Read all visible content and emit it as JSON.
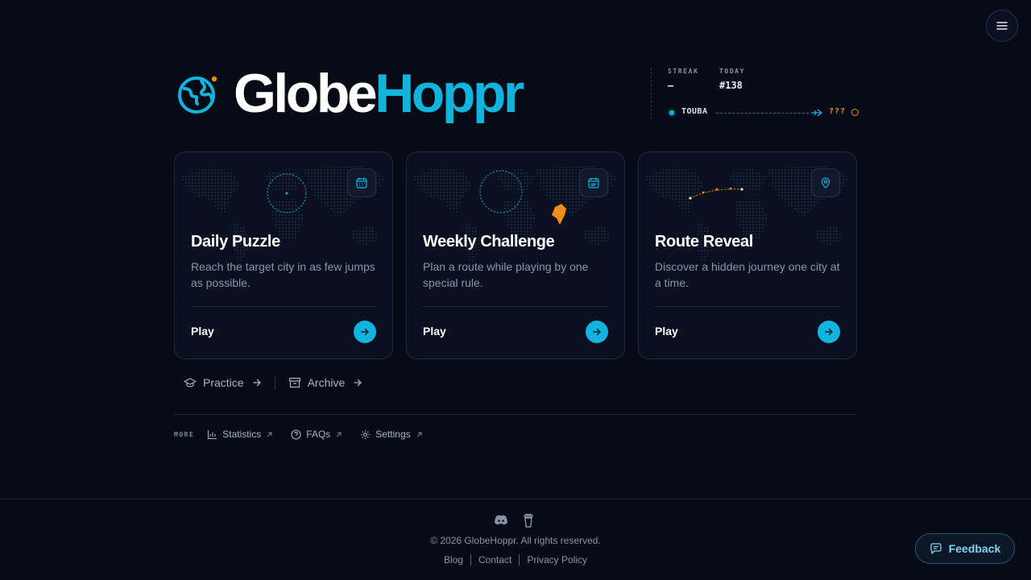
{
  "brand": {
    "part1": "Globe",
    "part2": "Hoppr",
    "accent": "#12b3dc",
    "orange": "#f08c1a"
  },
  "stats": {
    "streak_label": "STREAK",
    "streak_value": "–",
    "today_label": "TODAY",
    "today_value": "#138",
    "from_city": "TOUBA",
    "target": "???"
  },
  "cards": [
    {
      "title": "Daily Puzzle",
      "description": "Reach the target city in as few jumps as possible.",
      "play": "Play",
      "icon": "calendar-icon"
    },
    {
      "title": "Weekly Challenge",
      "description": "Plan a route while playing by one special rule.",
      "play": "Play",
      "icon": "calendar-week-icon"
    },
    {
      "title": "Route Reveal",
      "description": "Discover a hidden journey one city at a time.",
      "play": "Play",
      "icon": "map-pin-icon"
    }
  ],
  "sublinks": {
    "practice": "Practice",
    "archive": "Archive"
  },
  "more": {
    "tag": "MORE",
    "statistics": "Statistics",
    "faqs": "FAQs",
    "settings": "Settings"
  },
  "footer": {
    "copyright": "© 2026 GlobeHoppr. All rights reserved.",
    "blog": "Blog",
    "contact": "Contact",
    "privacy": "Privacy Policy"
  },
  "feedback": "Feedback"
}
